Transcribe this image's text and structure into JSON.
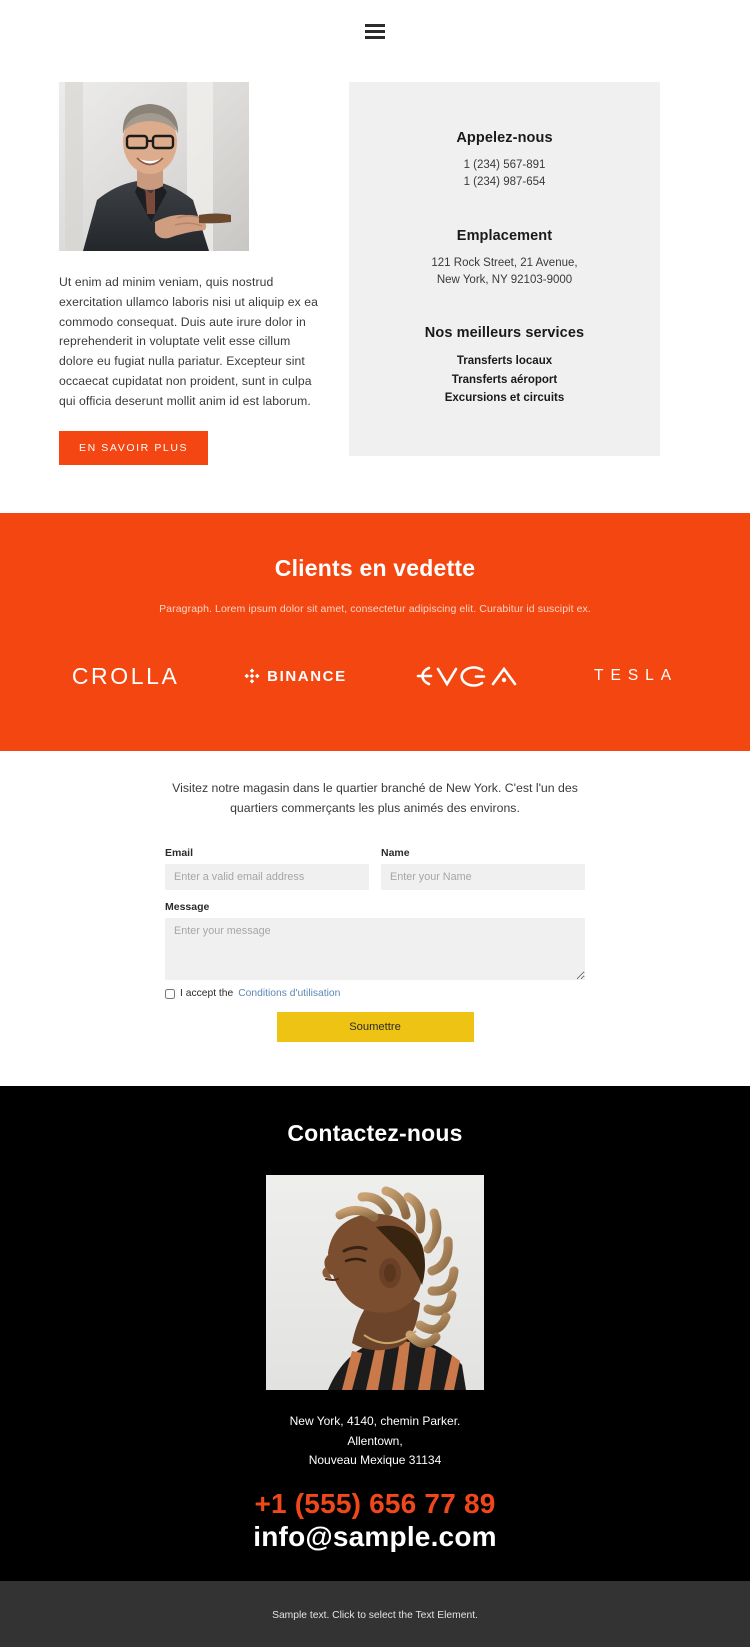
{
  "header": {
    "menu_icon": "hamburger-menu-icon"
  },
  "intro": {
    "paragraph": "Ut enim ad minim veniam, quis nostrud exercitation ullamco laboris nisi ut aliquip ex ea commodo consequat. Duis aute irure dolor in reprehenderit in voluptate velit esse cillum dolore eu fugiat nulla pariatur. Excepteur sint occaecat cupidatat non proident, sunt in culpa qui officia deserunt mollit anim id est laborum.",
    "cta_label": "EN SAVOIR PLUS",
    "portrait_alt": "smiling-man-with-glasses-portrait"
  },
  "info_panel": {
    "call_title": "Appelez-nous",
    "phone_1": "1 (234) 567-891",
    "phone_2": "1 (234) 987-654",
    "location_title": "Emplacement",
    "address_line_1": "121 Rock Street, 21 Avenue,",
    "address_line_2": "New York, NY 92103-9000",
    "services_title": "Nos meilleurs services",
    "services": [
      "Transferts locaux",
      "Transferts aéroport",
      "Excursions et circuits"
    ]
  },
  "clients": {
    "title": "Clients en vedette",
    "subtitle": "Paragraph. Lorem ipsum dolor sit amet, consectetur adipiscing elit. Curabitur id suscipit ex.",
    "logos": [
      {
        "name": "CROLLA",
        "id": "crolla-logo"
      },
      {
        "name": "BINANCE",
        "id": "binance-logo"
      },
      {
        "name": "EVGA",
        "id": "evga-logo"
      },
      {
        "name": "TESLA",
        "id": "tesla-logo"
      }
    ],
    "background_color": "#f44610"
  },
  "form": {
    "intro_line_1": "Visitez notre magasin dans le quartier branché de New York.",
    "intro_line_2": "C'est l'un des quartiers commerçants les plus animés des environs.",
    "email_label": "Email",
    "email_placeholder": "Enter a valid email address",
    "email_value": "",
    "name_label": "Name",
    "name_placeholder": "Enter your Name",
    "name_value": "",
    "message_label": "Message",
    "message_placeholder": "Enter your message",
    "message_value": "",
    "accept_text": "I accept the",
    "accept_link": "Conditions d'utilisation",
    "submit_label": "Soumettre",
    "submit_color": "#efc313"
  },
  "footer": {
    "title": "Contactez-nous",
    "photo_alt": "profile-portrait-person-with-dreadlocks",
    "address_line_1": "New York, 4140, chemin Parker.",
    "address_line_2": "Allentown,",
    "address_line_3": "Nouveau Mexique 31134",
    "phone": "+1 (555) 656 77 89",
    "email": "info@sample.com",
    "phone_color": "#f1481b"
  },
  "bottom_bar": {
    "text": "Sample text. Click to select the Text Element."
  }
}
